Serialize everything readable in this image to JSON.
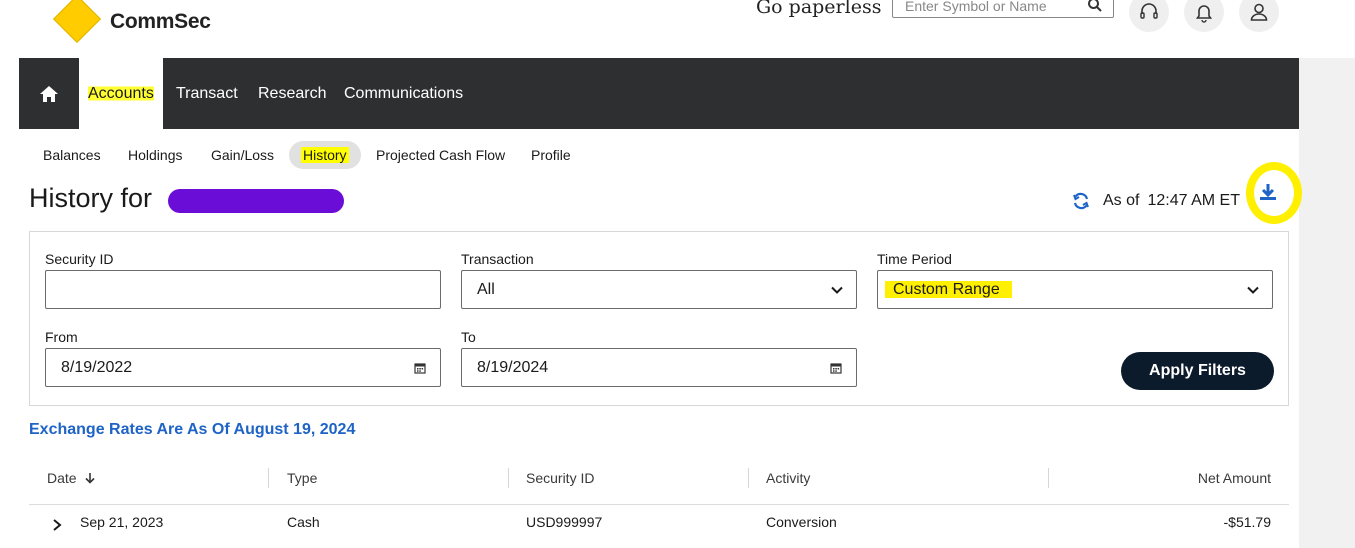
{
  "header": {
    "brand": "CommSec",
    "go_paperless": "Go paperless",
    "search_placeholder": "Enter Symbol or Name"
  },
  "main_nav": {
    "items": [
      {
        "label": "Accounts",
        "active": true
      },
      {
        "label": "Transact"
      },
      {
        "label": "Research"
      },
      {
        "label": "Communications"
      }
    ]
  },
  "sub_nav": {
    "items": [
      {
        "label": "Balances"
      },
      {
        "label": "Holdings"
      },
      {
        "label": "Gain/Loss"
      },
      {
        "label": "History",
        "active": true
      },
      {
        "label": "Projected Cash Flow"
      },
      {
        "label": "Profile"
      }
    ]
  },
  "page": {
    "title": "History for",
    "as_of_label": "As of",
    "as_of_time": "12:47 AM ET"
  },
  "filters": {
    "security_id": {
      "label": "Security ID",
      "value": ""
    },
    "transaction": {
      "label": "Transaction",
      "value": "All"
    },
    "time_period": {
      "label": "Time Period",
      "value": "Custom Range"
    },
    "from": {
      "label": "From",
      "value": "8/19/2022"
    },
    "to": {
      "label": "To",
      "value": "8/19/2024"
    },
    "apply_label": "Apply Filters"
  },
  "exchange_note": "Exchange Rates Are As Of August 19, 2024",
  "table": {
    "columns": [
      "Date",
      "Type",
      "Security ID",
      "Activity",
      "Net Amount"
    ],
    "rows": [
      {
        "date": "Sep 21, 2023",
        "type": "Cash",
        "security_id": "USD999997",
        "activity": "Conversion",
        "net_amount": "-$51.79"
      }
    ]
  },
  "colors": {
    "nav_bg": "#2d2f31",
    "highlight": "#ffff00",
    "link_blue": "#1e63c6",
    "apply_button": "#0b1b2b",
    "redaction": "#6a0dd6"
  }
}
